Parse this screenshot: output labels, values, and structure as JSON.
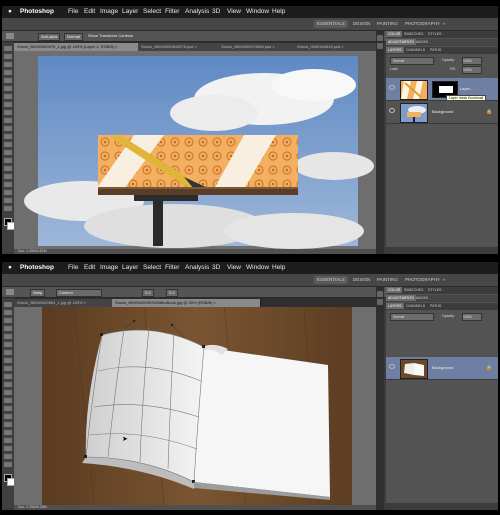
{
  "app": {
    "apple_icon": "apple-icon",
    "name": "Photoshop"
  },
  "menus": [
    "File",
    "Edit",
    "Image",
    "Layer",
    "Select",
    "Filter",
    "Analysis",
    "3D",
    "View",
    "Window",
    "Help"
  ],
  "workspaces": [
    "ESSENTIALS",
    "DESIGN",
    "PAINTING",
    "PHOTOGRAPHY",
    "»"
  ],
  "top": {
    "options": {
      "antialias": "Anti-alias",
      "style": "Normal",
      "refine": "Show Transform Controls"
    },
    "tabs": [
      "Shock_B0000000975_1.jpg @ 100% (Layer 1, RGB/8) ×",
      "Shock_B0000000840576.psd ×",
      "Shock_B000000074086.psd ×",
      "Shock_0000164519.psd ×"
    ],
    "status": "Doc: 1.25M/4.51M",
    "panels": {
      "top_tabs": [
        "COLOR",
        "SWATCHES",
        "STYLES"
      ],
      "sub_tabs": [
        "ADJUSTMENTS",
        "MASKS"
      ],
      "layer_tabs": [
        "LAYERS",
        "CHANNELS",
        "PATHS"
      ],
      "blend": "Normal",
      "opacity_label": "Opacity:",
      "opacity": "100%",
      "fill_label": "Fill:",
      "fill": "100%",
      "lock_label": "Lock:",
      "layers": [
        {
          "name": "Layer...",
          "selected": true
        },
        {
          "name": "Background",
          "selected": false
        }
      ],
      "tooltip": "Layer mask thumbnail"
    }
  },
  "bottom": {
    "options": {
      "mode": "Warp",
      "preset": "Custom",
      "h": "0.0",
      "v": "0.0"
    },
    "tabs": [
      "Shock_B0000000964_1.jpg @ 100% ×",
      "Shock_B00000000976308hoBook.jpg @ 33% (RGB/8) ×"
    ],
    "status": "Doc: 2.25M/6.25M",
    "panels": {
      "top_tabs": [
        "COLOR",
        "SWATCHES",
        "STYLES"
      ],
      "sub_tabs": [
        "ADJUSTMENTS",
        "MASKS"
      ],
      "layer_tabs": [
        "LAYERS",
        "CHANNELS",
        "PATHS"
      ],
      "blend": "Normal",
      "opacity_label": "Opacity:",
      "opacity": "100%",
      "layers": [
        {
          "name": "Background",
          "selected": true
        }
      ]
    }
  },
  "colors": {
    "panel_bg": "#535353",
    "menubar": "#1d1d1d",
    "selection": "#6f7fa3",
    "sky": "#6f95c8",
    "wood": "#6b4a2a",
    "billboard_orange": "#f0a04a"
  }
}
